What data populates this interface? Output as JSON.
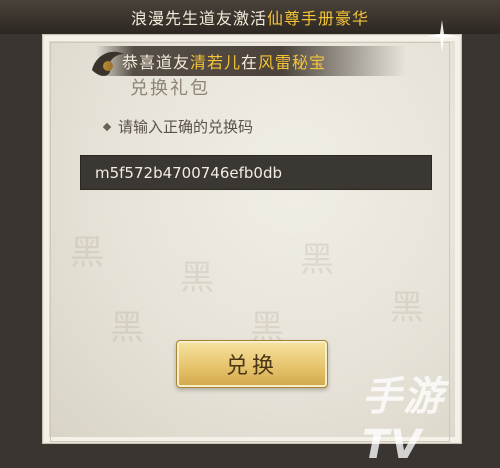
{
  "banner": {
    "prefix": "浪漫先生道友激活",
    "highlight": "仙尊手册豪华"
  },
  "ribbon": {
    "prefix": "恭喜道友",
    "name": "清若儿",
    "middle": "在",
    "location": "风雷秘宝"
  },
  "panel": {
    "title": "兑换礼包"
  },
  "form": {
    "prompt": "请输入正确的兑换码",
    "code_value": "m5f572b4700746efb0db",
    "submit_label": "兑换"
  },
  "watermark": {
    "text": "手游TV"
  },
  "colors": {
    "highlight": "#f4c437",
    "input_bg": "#3b3833",
    "button_gold": "#e7c56e"
  }
}
